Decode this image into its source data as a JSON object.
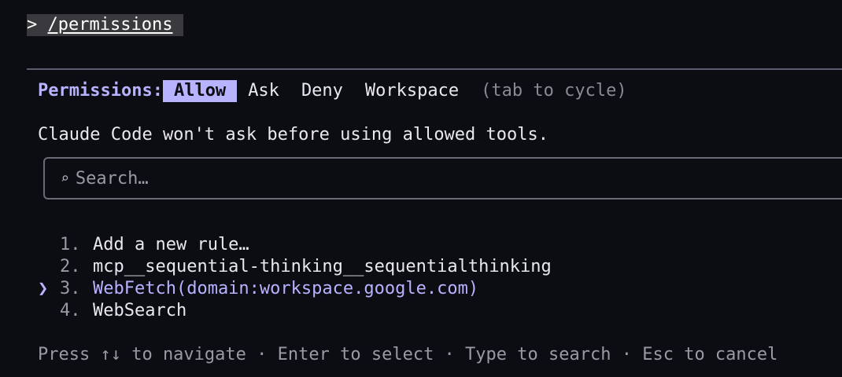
{
  "prompt": {
    "symbol": ">",
    "command": "/permissions"
  },
  "permissions": {
    "label": "Permissions:",
    "tabs": [
      {
        "label": "Allow",
        "active": true
      },
      {
        "label": "Ask",
        "active": false
      },
      {
        "label": "Deny",
        "active": false
      },
      {
        "label": "Workspace",
        "active": false
      }
    ],
    "hint": "(tab to cycle)",
    "description": "Claude Code won't ask before using allowed tools."
  },
  "search": {
    "icon": "search-icon",
    "icon_glyph": "⌕",
    "placeholder": "Search…",
    "value": ""
  },
  "rules": {
    "pointer": "❯",
    "items": [
      {
        "num": "1.",
        "label": "Add a new rule…"
      },
      {
        "num": "2.",
        "label": "mcp__sequential-thinking__sequentialthinking"
      },
      {
        "num": "3.",
        "label": "WebFetch(domain:workspace.google.com)"
      },
      {
        "num": "4.",
        "label": "WebSearch"
      }
    ],
    "selected_index": 2
  },
  "footer": "Press ↑↓ to navigate · Enter to select · Type to search · Esc to cancel",
  "colors": {
    "background": "#0c0c13",
    "accent": "#b7b3ff",
    "muted": "#9a9aa4"
  }
}
